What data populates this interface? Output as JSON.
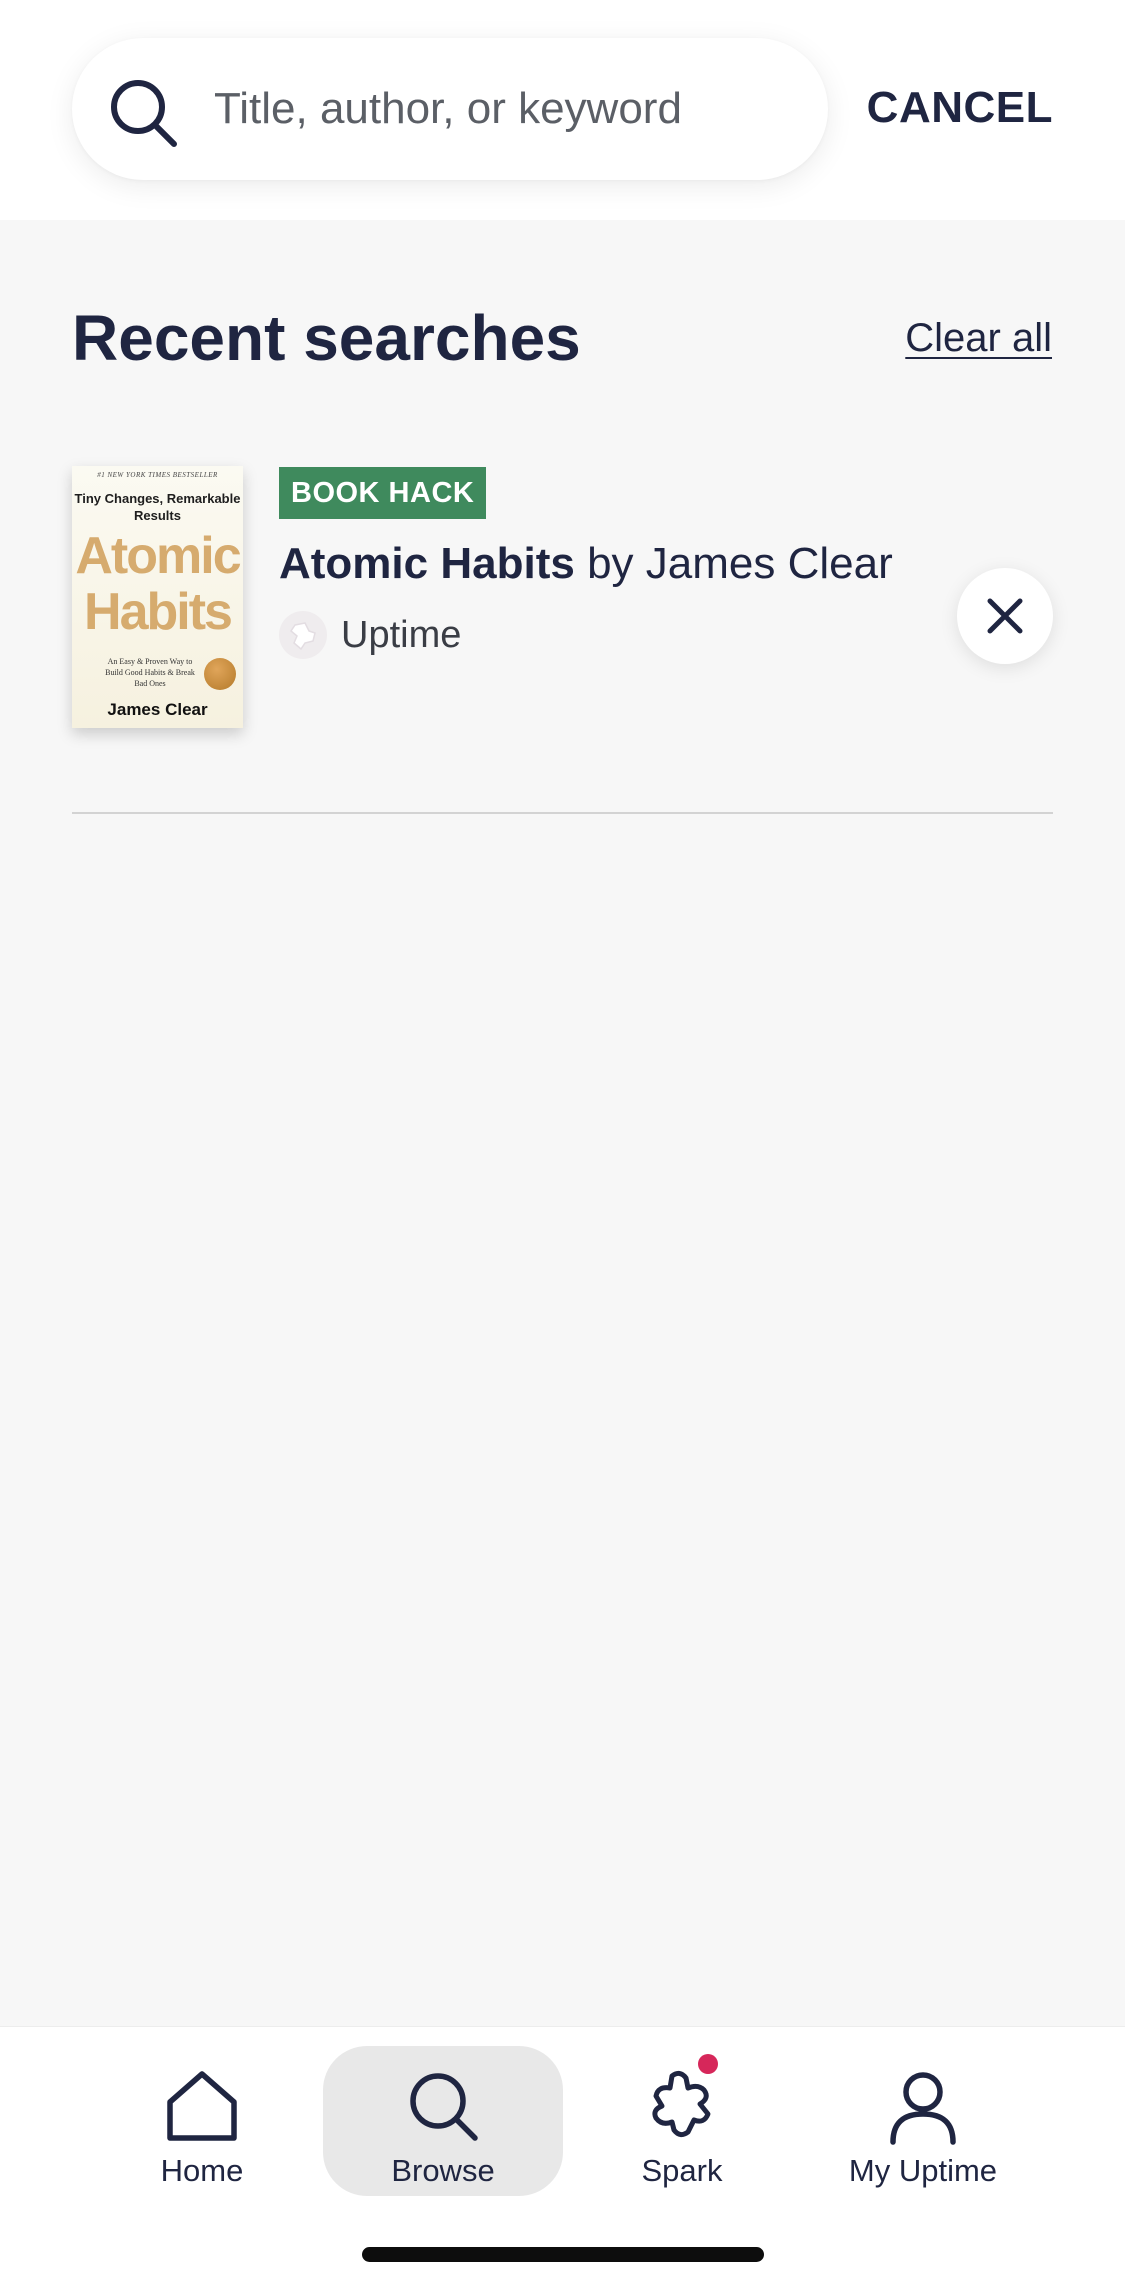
{
  "search": {
    "placeholder": "Title, author, or keyword",
    "value": "",
    "cancel_label": "CANCEL"
  },
  "recent": {
    "title": "Recent searches",
    "clear_all_label": "Clear all",
    "items": [
      {
        "badge": "BOOK HACK",
        "badge_color": "#3f8a5d",
        "book_title": "Atomic Habits",
        "by": "by",
        "author": "James Clear",
        "source": "Uptime",
        "cover": {
          "top_line": "#1 NEW YORK TIMES BESTSELLER",
          "subtitle": "Tiny Changes, Remarkable Results",
          "title": "Atomic Habits",
          "blurb": "An Easy & Proven Way to Build Good Habits & Break Bad Ones",
          "author": "James Clear"
        }
      }
    ]
  },
  "tabs": [
    {
      "label": "Home",
      "icon": "home-icon",
      "active": false
    },
    {
      "label": "Browse",
      "icon": "search-icon",
      "active": true
    },
    {
      "label": "Spark",
      "icon": "puzzle-icon",
      "active": false,
      "notification": true
    },
    {
      "label": "My Uptime",
      "icon": "user-icon",
      "active": false
    }
  ],
  "colors": {
    "primary_text": "#1f2541",
    "background": "#f7f7f7",
    "badge_green": "#3f8a5d",
    "notification_dot": "#d6275a",
    "active_tab_bg": "#e8e8e8"
  }
}
